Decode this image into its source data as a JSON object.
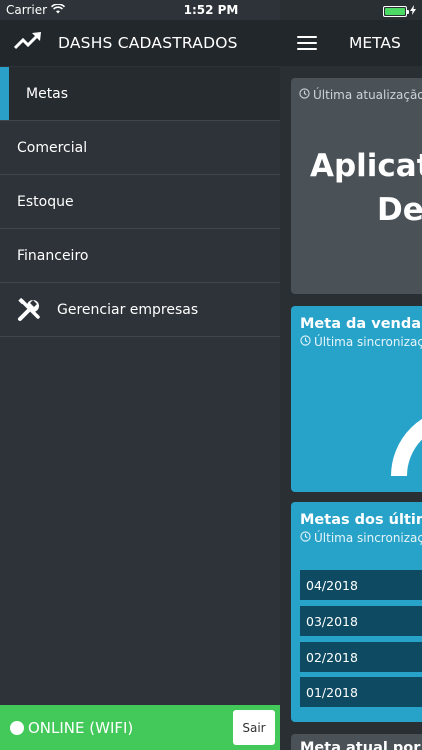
{
  "status_bar": {
    "carrier": "Carrier",
    "time": "1:52 PM",
    "wifi_icon": "wifi-icon",
    "battery_icon": "battery-icon",
    "battery_color": "#4cd964"
  },
  "sidebar": {
    "header_icon": "trending-up-icon",
    "header_title": "DASHS CADASTRADOS",
    "items": [
      {
        "label": "Metas",
        "active": true
      },
      {
        "label": "Comercial"
      },
      {
        "label": "Estoque"
      },
      {
        "label": "Financeiro"
      },
      {
        "label": "Gerenciar empresas",
        "icon": "tools-icon"
      }
    ],
    "footer": {
      "status_text": "ONLINE (WIFI)",
      "logout_label": "Sair",
      "color": "#43c85a"
    }
  },
  "main": {
    "menu_icon": "hamburger-menu-icon",
    "title": "METAS",
    "cards": {
      "info": {
        "timestamp_label": "Última atualização",
        "heading_line1": "Aplicat",
        "heading_line2": "Dem"
      },
      "sales_goal": {
        "title": "Meta da venda m",
        "subtitle": "Última sincronizaç"
      },
      "recent_goals": {
        "title": "Metas dos últim",
        "subtitle": "Última sincronizaç",
        "months": [
          "04/2018",
          "03/2018",
          "02/2018",
          "01/2018"
        ]
      },
      "current_goal": {
        "title": "Meta atual por"
      }
    },
    "accent_color": "#27a3c9"
  }
}
